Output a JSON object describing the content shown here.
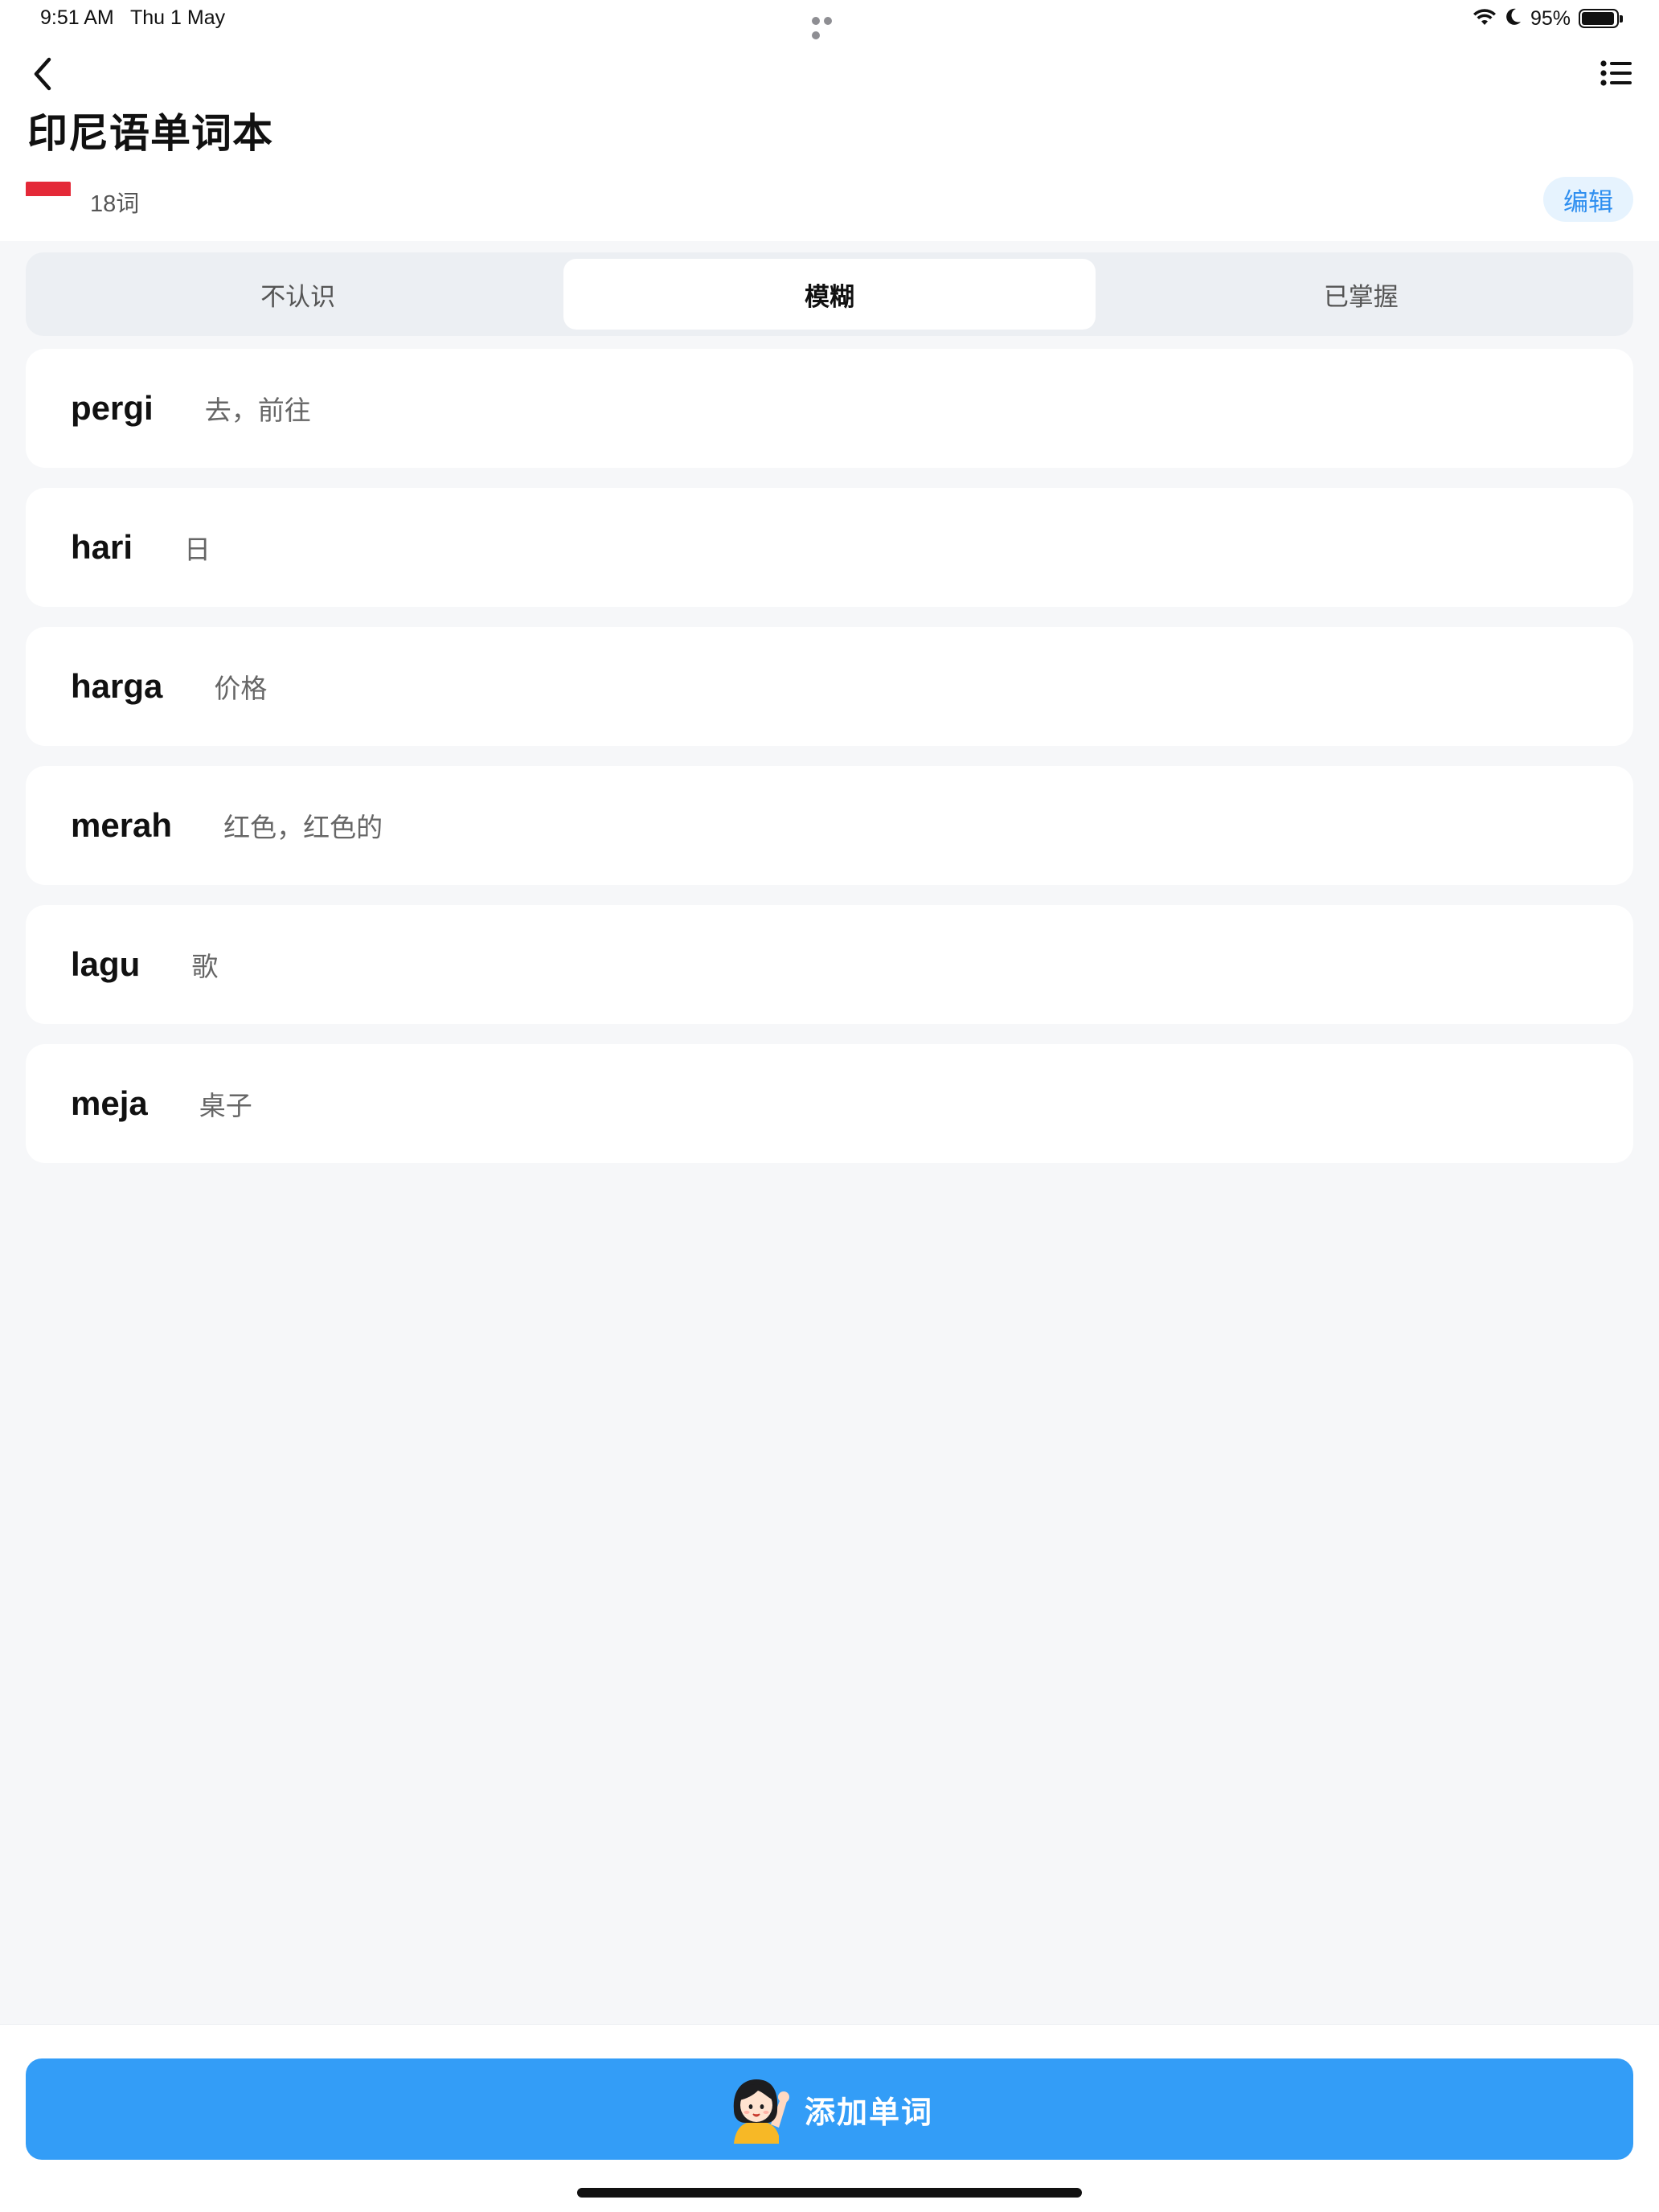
{
  "status_bar": {
    "time": "9:51 AM",
    "date": "Thu 1 May",
    "battery": "95%",
    "battery_level": 0.95,
    "icons": [
      "wifi-icon",
      "moon-icon",
      "battery-icon"
    ]
  },
  "header": {
    "title": "印尼语单词本",
    "word_count": "18词",
    "edit_label": "编辑",
    "flag": "indonesia-flag-icon",
    "back_icon": "chevron-left-icon",
    "menu_icon": "list-icon"
  },
  "tabs": [
    {
      "label": "不认识",
      "active": false
    },
    {
      "label": "模糊",
      "active": true
    },
    {
      "label": "已掌握",
      "active": false
    }
  ],
  "words": [
    {
      "word": "pergi",
      "meaning": "去，前往"
    },
    {
      "word": "hari",
      "meaning": "日"
    },
    {
      "word": "harga",
      "meaning": "价格"
    },
    {
      "word": "merah",
      "meaning": "红色，红色的"
    },
    {
      "word": "lagu",
      "meaning": "歌"
    },
    {
      "word": "meja",
      "meaning": "桌子"
    }
  ],
  "add_button": {
    "label": "添加单词",
    "icon": "waving-girl-icon"
  },
  "colors": {
    "accent": "#339df7",
    "edit_bg": "#e6f3fe",
    "edit_text": "#2f8ff0",
    "page_bg": "#f6f7f9",
    "flag_red": "#e42938"
  }
}
